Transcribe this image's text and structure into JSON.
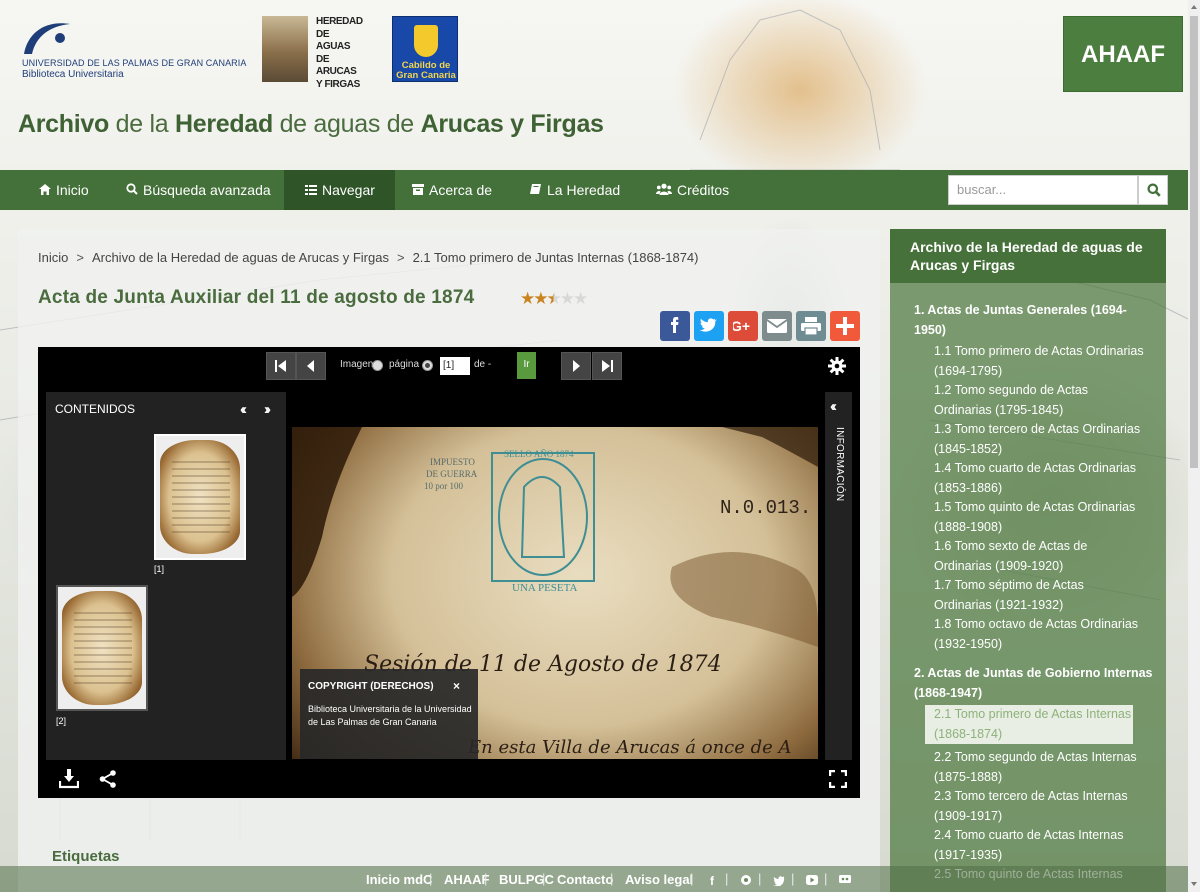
{
  "header": {
    "ulpgc_line1": "UNIVERSIDAD DE LAS PALMAS DE GRAN CANARIA",
    "ulpgc_line2": "Biblioteca Universitaria",
    "heredad_lines": [
      "HEREDAD",
      "DE AGUAS",
      "DE ARUCAS",
      "Y FIRGAS"
    ],
    "cabildo_lines": [
      "Cabildo de",
      "Gran Canaria"
    ],
    "ahaaf_label": "AHAAF",
    "title_parts": [
      "Archivo",
      " de la ",
      "Heredad",
      " de aguas de ",
      "Arucas y Firgas"
    ]
  },
  "nav": {
    "items": [
      {
        "label": "Inicio",
        "icon": "home-icon"
      },
      {
        "label": "Búsqueda avanzada",
        "icon": "search-icon"
      },
      {
        "label": "Navegar",
        "icon": "list-icon"
      },
      {
        "label": "Acerca de",
        "icon": "archive-icon"
      },
      {
        "label": "La Heredad",
        "icon": "book-icon"
      },
      {
        "label": "Créditos",
        "icon": "users-icon"
      }
    ],
    "active": "Navegar",
    "search_placeholder": "buscar..."
  },
  "breadcrumb": [
    "Inicio",
    "Archivo de la Heredad de aguas de Arucas y Firgas",
    "2.1 Tomo primero de Juntas Internas (1868-1874)"
  ],
  "breadcrumb_sep": ">",
  "page_title": "Acta de Junta Auxiliar del 11 de agosto de 1874",
  "rating": {
    "value": 2.5,
    "max": 5
  },
  "share_buttons": [
    {
      "name": "facebook",
      "color": "#3b5998"
    },
    {
      "name": "twitter",
      "color": "#1da1f2"
    },
    {
      "name": "google-plus",
      "color": "#dd4b39"
    },
    {
      "name": "email",
      "color": "#7f8c8d"
    },
    {
      "name": "print",
      "color": "#6f8c93"
    },
    {
      "name": "more",
      "color": "#f05a3a"
    }
  ],
  "viewer": {
    "mode_image": "Imagen",
    "mode_page": "página",
    "page_value": "[1]",
    "page_of": "de -",
    "go_label": "Ir",
    "contents_title": "CONTENIDOS",
    "info_title": "INFORMACIÓN",
    "thumbnails": [
      "[1]",
      "[2]"
    ],
    "copyright_title": "COPYRIGHT (DERECHOS)",
    "copyright_close": "×",
    "copyright_body": "Biblioteca Universitaria de la Universidad de Las Palmas de Gran Canaria"
  },
  "tags_label": "Etiquetas",
  "sidebar": {
    "title": "Archivo de la Heredad de aguas de Arucas y Firgas",
    "sections": [
      {
        "label": "1. Actas de Juntas Generales (1694-1950)",
        "items": [
          "1.1 Tomo primero de Actas Ordinarias (1694-1795)",
          "1.2 Tomo segundo de Actas Ordinarias (1795-1845)",
          "1.3 Tomo tercero de Actas Ordinarias (1845-1852)",
          "1.4 Tomo cuarto de Actas Ordinarias (1853-1886)",
          "1.5 Tomo quinto de Actas Ordinarias (1888-1908)",
          "1.6 Tomo sexto de Actas de Ordinarias (1909-1920)",
          "1.7 Tomo séptimo de Actas Ordinarias (1921-1932)",
          "1.8 Tomo octavo de Actas Ordinarias (1932-1950)"
        ]
      },
      {
        "label": "2. Actas de Juntas de Gobierno Internas (1868-1947)",
        "items": [
          "2.1 Tomo primero de Actas Internas (1868-1874)",
          "2.2 Tomo segundo de Actas Internas (1875-1888)",
          "2.3 Tomo tercero de Actas Internas (1909-1917)",
          "2.4 Tomo cuarto de Actas Internas (1917-1935)",
          "2.5 Tomo quinto de Actas Internas"
        ]
      }
    ],
    "current": "2.1 Tomo primero de Actas Internas (1868-1874)"
  },
  "footer": {
    "links": [
      "Inicio mdC",
      "AHAAF",
      "BULPGC",
      "Contacto",
      "Aviso legal"
    ],
    "social_icons": [
      "facebook-icon",
      "flickr-icon",
      "twitter-icon",
      "youtube-icon",
      "slideshare-icon"
    ]
  },
  "doc_image_text": {
    "stamp_top": "SELLO AÑO 1874",
    "stamp_bottom": "UNA PESETA",
    "impuesto": [
      "IMPUESTO",
      "DE GUERRA",
      "10 por 100"
    ],
    "number": "N.0.013.",
    "line1": "Sesión de 11 de Agosto de 1874",
    "line2": "En esta Villa de Arucas á once de A"
  }
}
